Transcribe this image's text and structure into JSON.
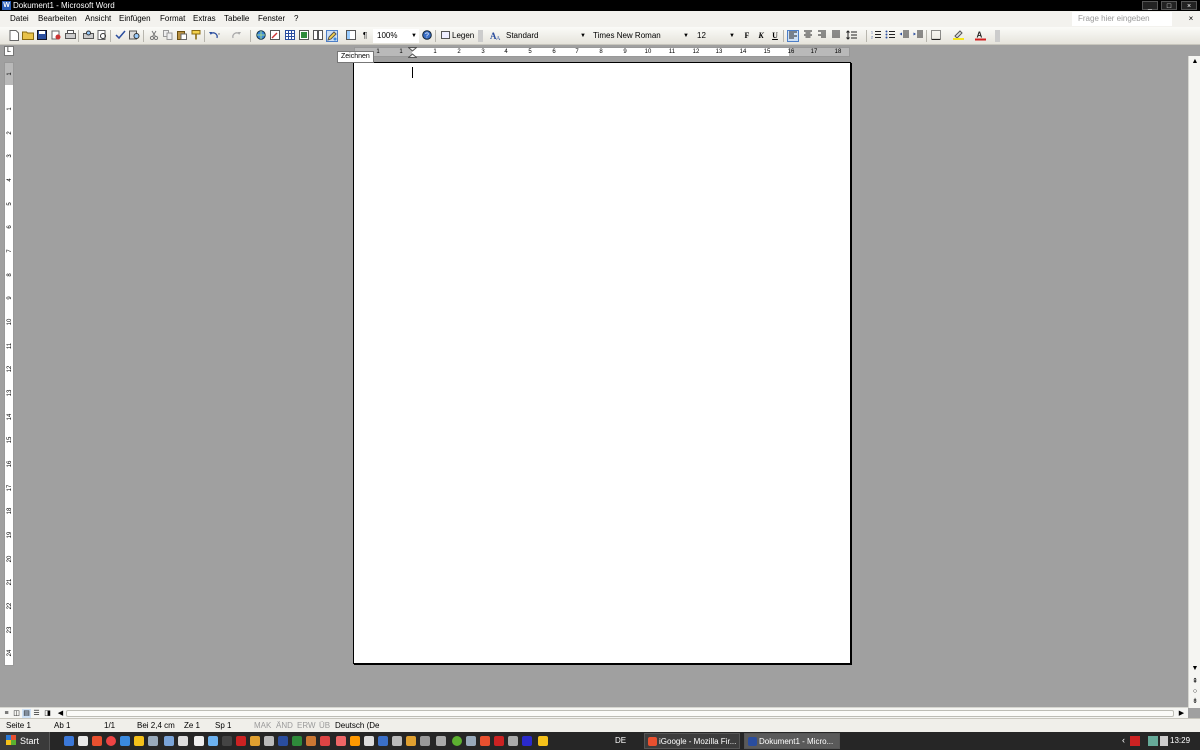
{
  "window": {
    "title": "Dokument1 - Microsoft Word",
    "min": "_",
    "max": "□",
    "close": "×"
  },
  "menu": [
    "Datei",
    "Bearbeiten",
    "Ansicht",
    "Einfügen",
    "Format",
    "Extras",
    "Tabelle",
    "Fenster",
    "?"
  ],
  "help_search": {
    "placeholder": "Frage hier eingeben"
  },
  "doc_close": "×",
  "toolbar": {
    "zoom": "100%",
    "legen": "Legen",
    "style": "Standard",
    "font": "Times New Roman",
    "size": "12",
    "bold": "F",
    "italic": "K",
    "underline": "U",
    "pilcrow": "¶",
    "tooltip": "Zeichnen"
  },
  "icons": [
    "new-icon",
    "open-icon",
    "save-icon",
    "permission-icon",
    "print-icon",
    "print-preview-icon",
    "spelling-icon",
    "research-icon",
    "cut-icon",
    "copy-icon",
    "paste-icon",
    "format-painter-icon",
    "undo-icon",
    "redo-icon",
    "hyperlink-icon",
    "tables-borders-icon",
    "insert-table-icon",
    "insert-excel-icon",
    "columns-icon",
    "drawing-icon",
    "document-map-icon",
    "show-formatting-icon",
    "help-icon",
    "align-left-icon",
    "center-icon",
    "align-right-icon",
    "justify-icon",
    "line-spacing-icon",
    "numbering-icon",
    "bullets-icon",
    "decrease-indent-icon",
    "increase-indent-icon",
    "border-icon",
    "highlight-icon",
    "font-color-icon"
  ],
  "ruler": {
    "h_left": [
      "1",
      "1"
    ],
    "h_right": [
      "1",
      "2",
      "3",
      "4",
      "5",
      "6",
      "7",
      "8",
      "9",
      "10",
      "11",
      "12",
      "13",
      "14",
      "15",
      "16",
      "17",
      "18"
    ],
    "v": [
      "1",
      "1",
      "2",
      "3",
      "4",
      "5",
      "6",
      "7",
      "8",
      "9",
      "10",
      "11",
      "12",
      "13",
      "14",
      "15",
      "16",
      "17",
      "18",
      "19",
      "20",
      "21",
      "22",
      "23",
      "24",
      "25"
    ]
  },
  "status": {
    "page": "Seite 1",
    "section": "Ab 1",
    "pages": "1/1",
    "at": "Bei 2,4 cm",
    "line": "Ze 1",
    "col": "Sp 1",
    "rec": "MAK",
    "trk": "ÄND",
    "ext": "ERW",
    "ovr": "ÜB",
    "lang": "Deutsch (De"
  },
  "taskbar": {
    "start": "Start",
    "lang": "DE",
    "tasks": [
      "iGoogle - Mozilla Fir...",
      "Dokument1 - Micro..."
    ],
    "clock": "13:29"
  },
  "colors": {
    "accent": "#2b5fb8",
    "app_bg": "#a0a0a0",
    "taskbar": "#262626"
  }
}
